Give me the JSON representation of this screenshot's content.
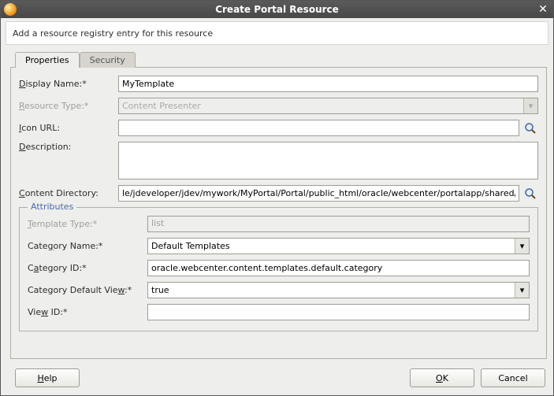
{
  "window": {
    "title": "Create Portal Resource",
    "close_glyph": "✕"
  },
  "infobar": "Add a resource registry entry for this resource",
  "tabs": {
    "properties": "Properties",
    "security": "Security"
  },
  "fields": {
    "display_name": {
      "label_pre": "D",
      "label_post": "isplay Name:*",
      "value": "MyTemplate"
    },
    "resource_type": {
      "label_pre": "R",
      "label_post": "esource Type:*",
      "value": "Content Presenter"
    },
    "icon_url": {
      "label_pre": "I",
      "label_post": "con URL:",
      "value": ""
    },
    "description": {
      "label_pre": "D",
      "label_post": "escription:",
      "value": ""
    },
    "content_directory": {
      "label_pre": "C",
      "label_post": "ontent Directory:",
      "value": "le/jdeveloper/jdev/mywork/MyPortal/Portal/public_html/oracle/webcenter/portalapp/shared/"
    }
  },
  "attributes": {
    "legend": "Attributes",
    "template_type": {
      "label_pre": "T",
      "label_post": "emplate Type:*",
      "value": "list"
    },
    "category_name": {
      "label_pre": "Cate",
      "label_ul": "g",
      "label_post": "ory Name:*",
      "value": "Default Templates"
    },
    "category_id": {
      "label_pre": "C",
      "label_ul": "a",
      "label_post": "tegory ID:*",
      "value": "oracle.webcenter.content.templates.default.category"
    },
    "category_default_view": {
      "label_pre": "Category Default Vie",
      "label_ul": "w",
      "label_post": ":*",
      "value": "true"
    },
    "view_id": {
      "label_pre": "Vie",
      "label_ul": "w",
      "label_post": " ID:*",
      "value": ""
    }
  },
  "buttons": {
    "help_pre": "H",
    "help_post": "elp",
    "ok_pre": "O",
    "ok_post": "K",
    "cancel": "Cancel"
  }
}
